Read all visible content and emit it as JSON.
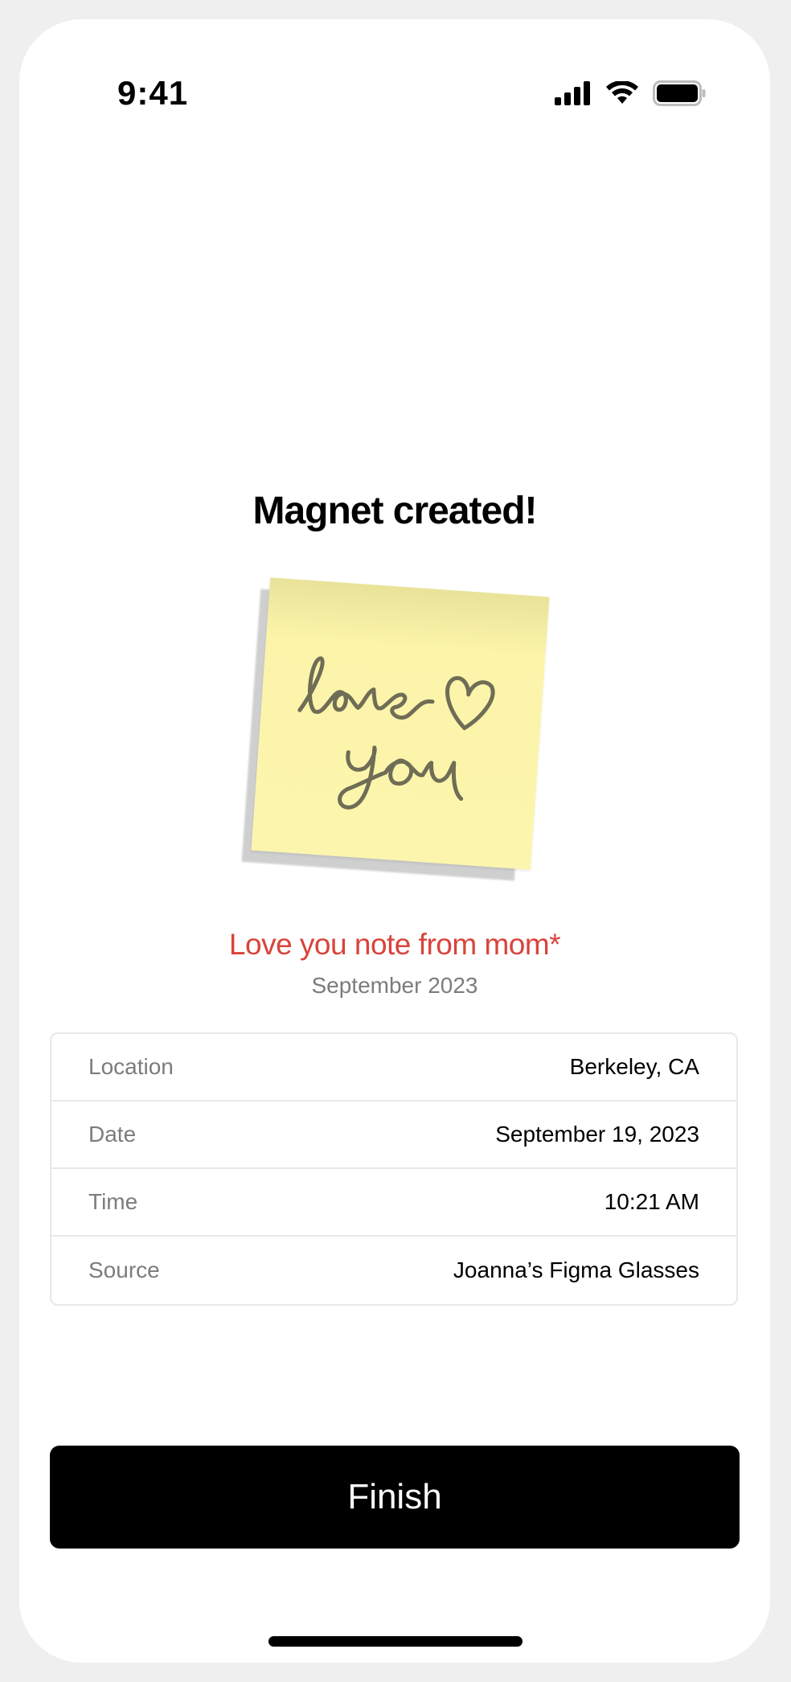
{
  "status_bar": {
    "time": "9:41",
    "icons": [
      "signal-icon",
      "wifi-icon",
      "battery-icon"
    ]
  },
  "title": "Magnet created!",
  "magnet": {
    "image": "sticky-note-love-you",
    "image_colors": {
      "note": "#fcf5ad",
      "ink": "#6f6d55"
    },
    "name": "Love you note from mom*",
    "name_color": "#d9433a",
    "date": "September 2023"
  },
  "details": [
    {
      "label": "Location",
      "value": "Berkeley, CA"
    },
    {
      "label": "Date",
      "value": "September 19, 2023"
    },
    {
      "label": "Time",
      "value": "10:21 AM"
    },
    {
      "label": "Source",
      "value": "Joanna’s Figma Glasses"
    }
  ],
  "finish_button": {
    "label": "Finish"
  }
}
